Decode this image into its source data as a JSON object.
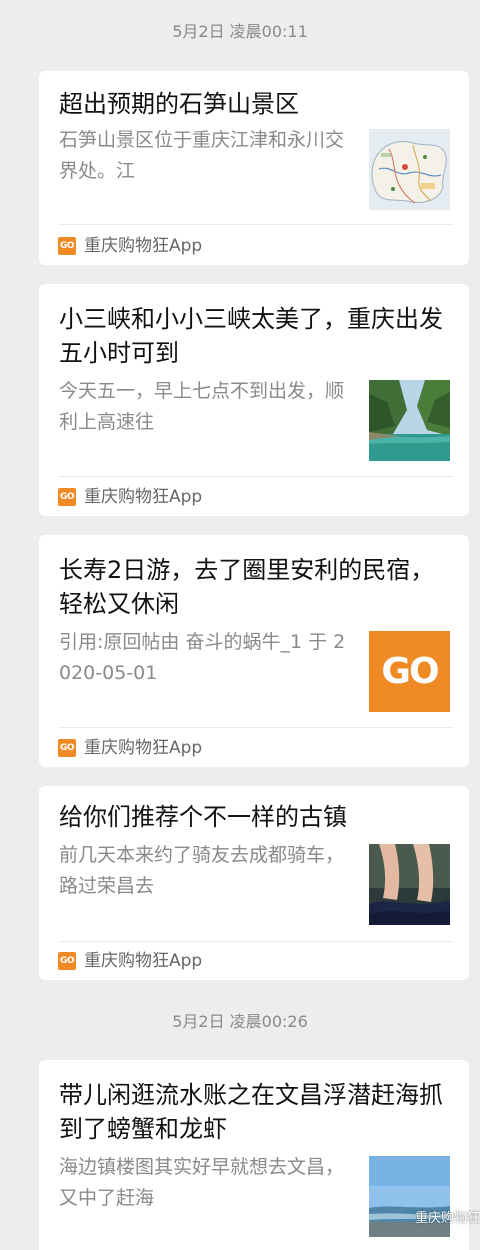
{
  "timestamps": [
    "5月2日 凌晨00:11",
    "5月2日 凌晨00:26"
  ],
  "source": {
    "name": "重庆购物狂App",
    "logo_text": "GO",
    "logo_color": "#f08a24"
  },
  "articles": [
    {
      "title": "超出预期的石笋山景区",
      "desc": "  石笋山景区位于重庆江津和永川交界处。江",
      "thumb": "map-thumbnail"
    },
    {
      "title": "小三峡和小小三峡太美了，重庆出发五小时可到",
      "desc": "今天五一，早上七点不到出发，顺利上高速往",
      "thumb": "gorge-river-thumbnail"
    },
    {
      "title": "长寿2日游，去了圈里安利的民宿，轻松又休闲",
      "desc": "引用:原回帖由 奋斗的蜗牛_1 于 2020-05-01",
      "thumb": "go-logo-thumbnail",
      "thumb_text": "GO"
    },
    {
      "title": "给你们推荐个不一样的古镇",
      "desc": "前几天本来约了骑友去成都骑车，路过荣昌去",
      "thumb": "feet-in-water-thumbnail"
    },
    {
      "title": "带儿闲逛流水账之在文昌浮潜赶海抓到了螃蟹和龙虾",
      "desc": "海边镇楼图其实好早就想去文昌，又中了赶海",
      "thumb": "beach-sky-thumbnail"
    }
  ],
  "watermark": "重庆购物狂"
}
